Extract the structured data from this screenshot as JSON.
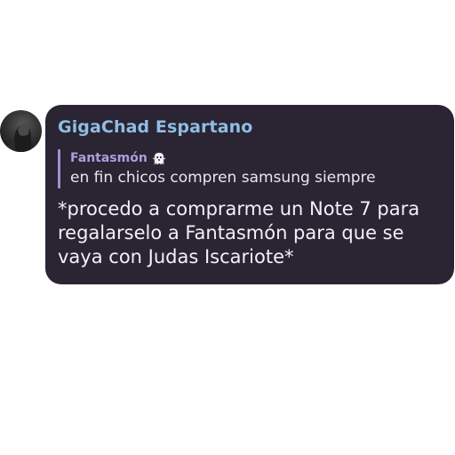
{
  "message": {
    "sender": "GigaChad Espartano",
    "avatar_icon": "avatar-photo",
    "reply": {
      "author": "Fantasmón",
      "author_emoji_icon": "ghost-icon",
      "text": "en fin chicos compren samsung siempre"
    },
    "body_lines": [
      "*procedo a comprarme un Note 7 para",
      "regalarselo a Fantasmón para que se",
      "vaya con Judas Iscariote*"
    ]
  },
  "colors": {
    "bubble_bg": "#2a2433",
    "sender": "#8fbde3",
    "reply_author": "#a99fe0",
    "reply_bar": "#9a92cf",
    "text": "#f3f1f6"
  }
}
